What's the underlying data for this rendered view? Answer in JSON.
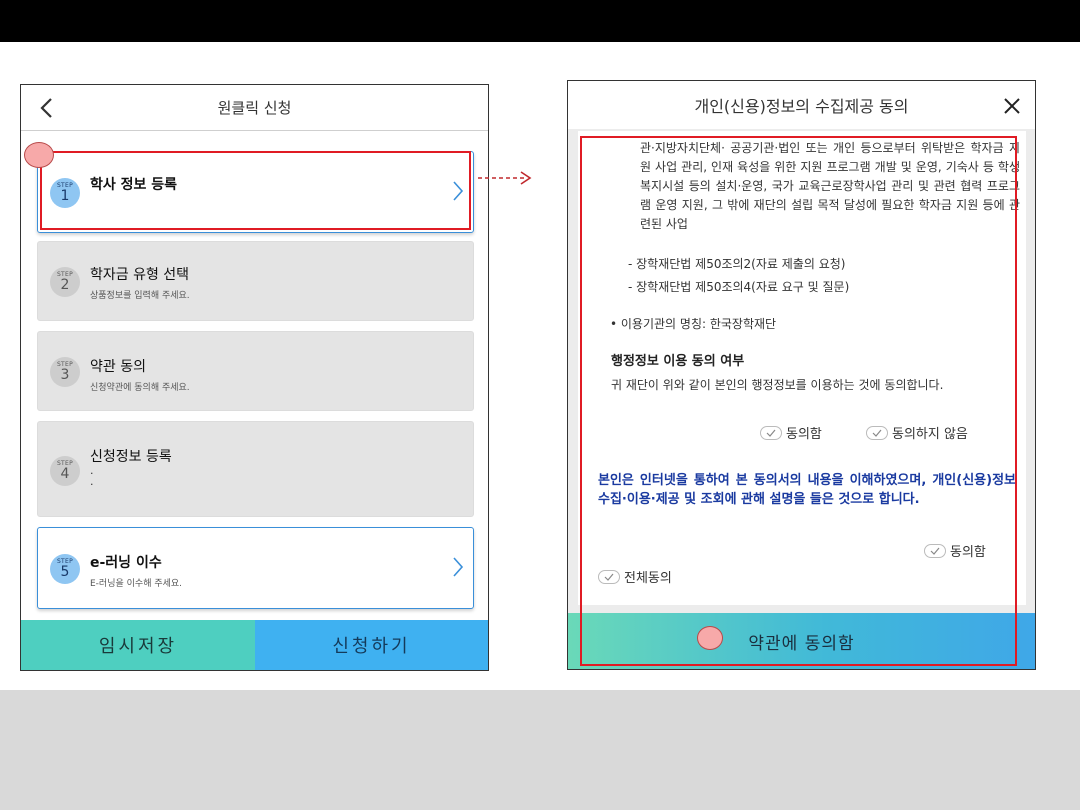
{
  "left_phone": {
    "title": "원클릭 신청",
    "steps": [
      {
        "step_label": "STEP",
        "number": "1",
        "title": "학사 정보 등록",
        "subtitle": ""
      },
      {
        "step_label": "STEP",
        "number": "2",
        "title": "학자금 유형 선택",
        "subtitle": "상품정보를 입력해 주세요."
      },
      {
        "step_label": "STEP",
        "number": "3",
        "title": "약관 동의",
        "subtitle": "신청약관에 동의해 주세요."
      },
      {
        "step_label": "STEP",
        "number": "4",
        "title": "신청정보 등록",
        "subtitle": ""
      },
      {
        "step_label": "STEP",
        "number": "5",
        "title": "e-러닝 이수",
        "subtitle": "E-러닝을 이수해 주세요."
      }
    ],
    "save_label": "임시저장",
    "apply_label": "신청하기"
  },
  "right_phone": {
    "title": "개인(신용)정보의 수집제공 동의",
    "para_top": "관·지방자치단체· 공공기관·법인 또는 개인 등으로부터 위탁받은 학자금 지원 사업 관리, 인재 육성을 위한 지원 프로그램 개발 및 운영, 기숙사 등 학생 복지시설 등의 설치·운영, 국가 교육근로장학사업 관리 및 관련 협력 프로그램 운영 지원, 그 밖에 재단의 설립 목적 달성에 필요한 학자금 지원 등에 관련된 사업",
    "dash1": "- 장학재단법 제50조의2(자료 제출의 요청)",
    "dash2": "- 장학재단법 제50조의4(자료 요구 및 질문)",
    "bullet": "• 이용기관의 명칭: 한국장학재단",
    "heading": "행정정보 이용 동의 여부",
    "text": "귀 재단이 위와 같이 본인의 행정정보를 이용하는 것에 동의합니다.",
    "agree": "동의함",
    "disagree": "동의하지 않음",
    "strong": "본인은 인터넷을 통하여 본 동의서의 내용을 이해하였으며, 개인(신용)정보 수집·이용·제공 및 조회에 관해 설명을 들은 것으로 합니다.",
    "agree2": "동의함",
    "agree_all": "전체동의",
    "footer_label": "약관에 동의함"
  },
  "colors": {
    "highlight": "#e01b24",
    "accent_blue": "#3a8fd9",
    "save_teal": "#4ecfc0",
    "apply_blue": "#3fb1f1"
  }
}
